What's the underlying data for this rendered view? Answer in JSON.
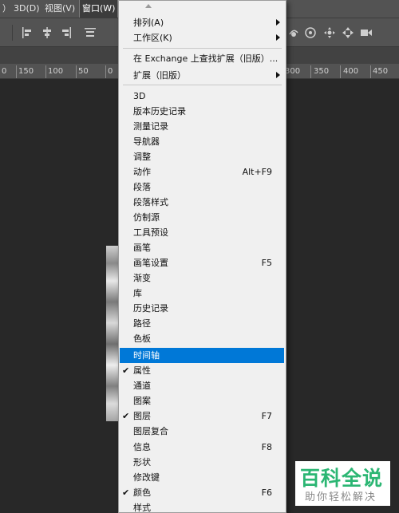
{
  "menubar": {
    "items": [
      "）",
      "3D(D)",
      "视图(V)",
      "窗口(W)"
    ]
  },
  "ruler": {
    "labels": [
      "0",
      "150",
      "100",
      "50",
      "0",
      "300",
      "350",
      "400",
      "450"
    ]
  },
  "window_menu": {
    "items": [
      {
        "label": "排列(A)",
        "submenu": true
      },
      {
        "label": "工作区(K)",
        "submenu": true
      },
      {
        "label": "在 Exchange 上查找扩展（旧版）..."
      },
      {
        "label": "扩展（旧版）",
        "submenu": true
      },
      {
        "label": "3D"
      },
      {
        "label": "版本历史记录"
      },
      {
        "label": "测量记录"
      },
      {
        "label": "导航器"
      },
      {
        "label": "调整"
      },
      {
        "label": "动作",
        "shortcut": "Alt+F9"
      },
      {
        "label": "段落"
      },
      {
        "label": "段落样式"
      },
      {
        "label": "仿制源"
      },
      {
        "label": "工具预设"
      },
      {
        "label": "画笔"
      },
      {
        "label": "画笔设置",
        "shortcut": "F5"
      },
      {
        "label": "渐变"
      },
      {
        "label": "库"
      },
      {
        "label": "历史记录"
      },
      {
        "label": "路径"
      },
      {
        "label": "色板"
      },
      {
        "label": "时间轴",
        "highlighted": true
      },
      {
        "label": "属性",
        "checked": true
      },
      {
        "label": "通道"
      },
      {
        "label": "图案"
      },
      {
        "label": "图层",
        "checked": true,
        "shortcut": "F7"
      },
      {
        "label": "图层复合"
      },
      {
        "label": "信息",
        "shortcut": "F8"
      },
      {
        "label": "形状"
      },
      {
        "label": "修改键"
      },
      {
        "label": "颜色",
        "checked": true,
        "shortcut": "F6"
      },
      {
        "label": "样式"
      }
    ]
  },
  "watermark": {
    "title": "百科全说",
    "subtitle": "助你轻松解决"
  },
  "colors": {
    "highlight": "#0078d7",
    "menu_bg": "#f0f0f0",
    "app_bg": "#282828",
    "toolbar": "#535353",
    "watermark_green": "#2bb673"
  }
}
